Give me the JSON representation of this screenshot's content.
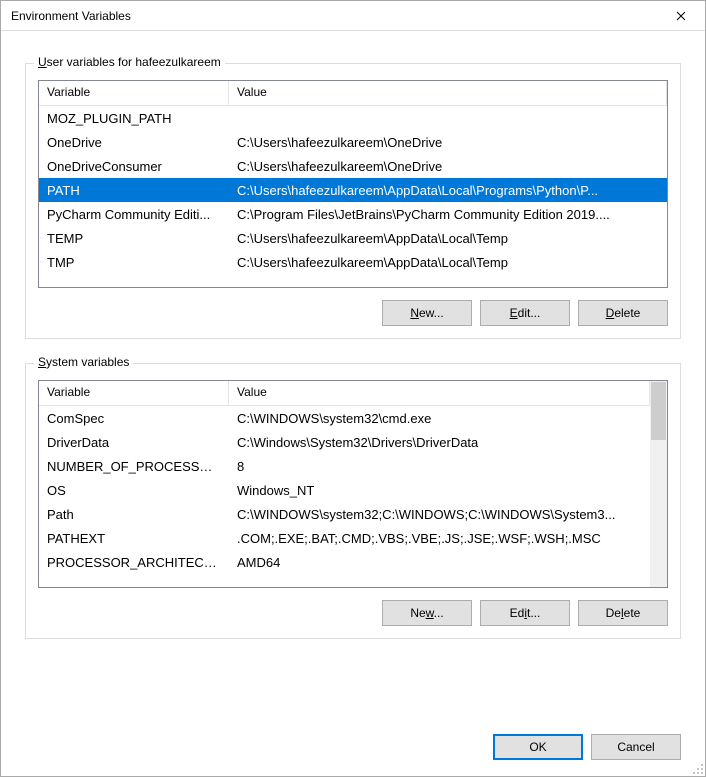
{
  "window": {
    "title": "Environment Variables"
  },
  "userGroup": {
    "label_pre": "U",
    "label_post": "ser variables for hafeezulkareem",
    "header": {
      "variable": "Variable",
      "value": "Value"
    },
    "rows": [
      {
        "variable": "MOZ_PLUGIN_PATH",
        "value": ""
      },
      {
        "variable": "OneDrive",
        "value": "C:\\Users\\hafeezulkareem\\OneDrive"
      },
      {
        "variable": "OneDriveConsumer",
        "value": "C:\\Users\\hafeezulkareem\\OneDrive"
      },
      {
        "variable": "PATH",
        "value": "C:\\Users\\hafeezulkareem\\AppData\\Local\\Programs\\Python\\P...",
        "selected": true
      },
      {
        "variable": "PyCharm Community Editi...",
        "value": "C:\\Program Files\\JetBrains\\PyCharm Community Edition 2019...."
      },
      {
        "variable": "TEMP",
        "value": "C:\\Users\\hafeezulkareem\\AppData\\Local\\Temp"
      },
      {
        "variable": "TMP",
        "value": "C:\\Users\\hafeezulkareem\\AppData\\Local\\Temp"
      }
    ],
    "buttons": {
      "new_u": "N",
      "new": "ew...",
      "edit_u": "E",
      "edit": "dit...",
      "delete_u": "D",
      "delete": "elete"
    }
  },
  "systemGroup": {
    "label_pre": "S",
    "label_post": "ystem variables",
    "header": {
      "variable": "Variable",
      "value": "Value"
    },
    "rows": [
      {
        "variable": "ComSpec",
        "value": "C:\\WINDOWS\\system32\\cmd.exe"
      },
      {
        "variable": "DriverData",
        "value": "C:\\Windows\\System32\\Drivers\\DriverData"
      },
      {
        "variable": "NUMBER_OF_PROCESSORS",
        "value": "8"
      },
      {
        "variable": "OS",
        "value": "Windows_NT"
      },
      {
        "variable": "Path",
        "value": "C:\\WINDOWS\\system32;C:\\WINDOWS;C:\\WINDOWS\\System3..."
      },
      {
        "variable": "PATHEXT",
        "value": ".COM;.EXE;.BAT;.CMD;.VBS;.VBE;.JS;.JSE;.WSF;.WSH;.MSC"
      },
      {
        "variable": "PROCESSOR_ARCHITECTU...",
        "value": "AMD64"
      }
    ],
    "buttons": {
      "new_u": "w",
      "new_pre": "Ne",
      "new_post": "...",
      "edit_u": "i",
      "edit_pre": "Ed",
      "edit_post": "t...",
      "delete_u": "l",
      "delete_pre": "De",
      "delete_post": "ete"
    }
  },
  "footer": {
    "ok": "OK",
    "cancel": "Cancel"
  }
}
